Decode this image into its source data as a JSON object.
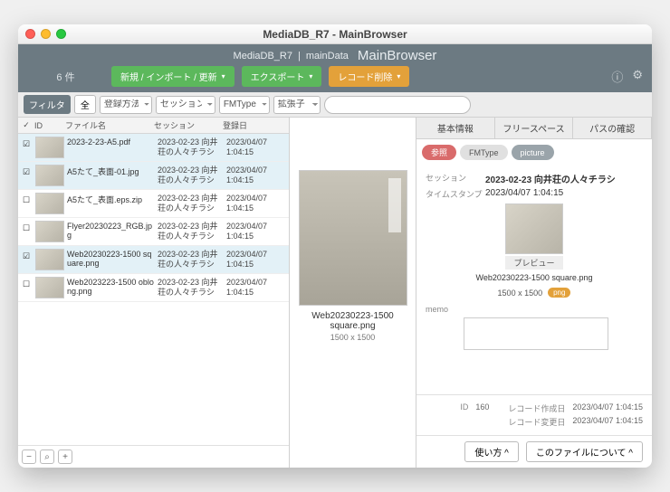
{
  "window": {
    "title": "MediaDB_R7 - MainBrowser"
  },
  "header": {
    "db": "MediaDB_R7",
    "sep": "|",
    "table": "mainData",
    "brand": "MainBrowser",
    "count": "6 件",
    "btn_new": "新規 / インポート / 更新",
    "btn_export": "エクスポート",
    "btn_delete": "レコード削除"
  },
  "toolbar": {
    "filter": "フィルタ",
    "all": "全",
    "sel1": "登録方法",
    "sel2": "セッション",
    "sel3": "FMType",
    "sel4": "拡張子",
    "search_ph": ""
  },
  "th": {
    "ck": "✓",
    "id": "ID",
    "name": "ファイル名",
    "sess": "セッション",
    "date": "登録日"
  },
  "rows": [
    {
      "sel": true,
      "name": "2023-2-23-A5.pdf",
      "sess": "2023-02-23 向井荘の人々チラシ",
      "date": "2023/04/07 1:04:15"
    },
    {
      "sel": true,
      "name": "A5たて_表面-01.jpg",
      "sess": "2023-02-23 向井荘の人々チラシ",
      "date": "2023/04/07 1:04:15"
    },
    {
      "sel": false,
      "name": "A5たて_表面.eps.zip",
      "sess": "2023-02-23 向井荘の人々チラシ",
      "date": "2023/04/07 1:04:15"
    },
    {
      "sel": false,
      "name": "Flyer20230223_RGB.jpg",
      "sess": "2023-02-23 向井荘の人々チラシ",
      "date": "2023/04/07 1:04:15"
    },
    {
      "sel": true,
      "name": "Web20230223-1500 square.png",
      "sess": "2023-02-23 向井荘の人々チラシ",
      "date": "2023/04/07 1:04:15"
    },
    {
      "sel": false,
      "name": "Web2023223-1500 oblong.png",
      "sess": "2023-02-23 向井荘の人々チラシ",
      "date": "2023/04/07 1:04:15"
    }
  ],
  "mid": {
    "name": "Web20230223-1500 square.png",
    "dim": "1500 x 1500"
  },
  "tabs": {
    "a": "基本情報",
    "b": "フリースペース",
    "c": "パスの確認"
  },
  "subtabs": {
    "a": "参照",
    "b": "FMType",
    "c": "picture"
  },
  "detail": {
    "sess_label": "セッション",
    "sess_val": "2023-02-23 向井荘の人々チラシ",
    "ts_label": "タイムスタンプ",
    "ts_val": "2023/04/07 1:04:15",
    "preview_cap": "プレビュー",
    "preview_name": "Web20230223-1500 square.png",
    "dim": "1500 x 1500",
    "ext": "png",
    "memo_label": "memo"
  },
  "footer": {
    "id_label": "ID",
    "id_val": "160",
    "created_label": "レコード作成日",
    "created_val": "2023/04/07 1:04:15",
    "modified_label": "レコード変更日",
    "modified_val": "2023/04/07 1:04:15"
  },
  "bottom": {
    "howto": "使い方 ^",
    "about": "このファイルについて ^"
  }
}
